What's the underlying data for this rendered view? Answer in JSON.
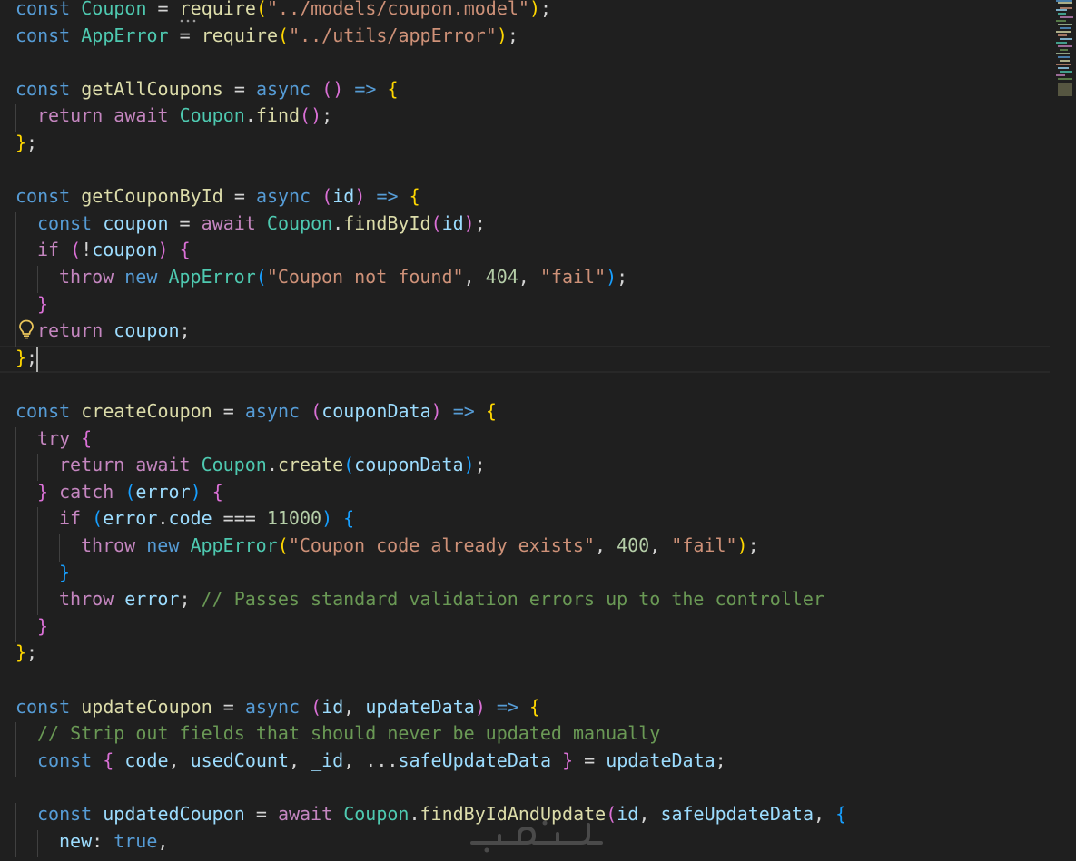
{
  "colors": {
    "background": "#1f1f1f",
    "keyword": "#569cd6",
    "control": "#c586c0",
    "variable": "#9cdcfe",
    "class": "#4ec9b0",
    "function": "#dcdcaa",
    "string": "#ce9178",
    "number": "#b5cea8",
    "comment": "#6a9955",
    "bracket1": "#ffd700",
    "bracket2": "#da70d6",
    "bracket3": "#179fff"
  },
  "editor": {
    "lightbulb_icon": "lightbulb-icon",
    "lines": [
      {
        "indent": 0,
        "tokens": [
          [
            "const",
            "kw"
          ],
          [
            " ",
            "pun"
          ],
          [
            "Coupon",
            "cls"
          ],
          [
            " = ",
            "op"
          ],
          [
            "require",
            "fn"
          ],
          [
            "(",
            "b1"
          ],
          [
            "\"../models/coupon.model\"",
            "str"
          ],
          [
            ")",
            "b1"
          ],
          [
            ";",
            "pun"
          ]
        ]
      },
      {
        "indent": 0,
        "tokens": [
          [
            "const",
            "kw"
          ],
          [
            " ",
            "pun"
          ],
          [
            "AppError",
            "cls"
          ],
          [
            " = ",
            "op"
          ],
          [
            "require",
            "fn"
          ],
          [
            "(",
            "b1"
          ],
          [
            "\"../utils/appError\"",
            "str"
          ],
          [
            ")",
            "b1"
          ],
          [
            ";",
            "pun"
          ]
        ]
      },
      {
        "indent": 0,
        "tokens": []
      },
      {
        "indent": 0,
        "tokens": [
          [
            "const",
            "kw"
          ],
          [
            " ",
            "pun"
          ],
          [
            "getAllCoupons",
            "fn"
          ],
          [
            " = ",
            "op"
          ],
          [
            "async",
            "kw"
          ],
          [
            " ",
            "pun"
          ],
          [
            "()",
            "b2"
          ],
          [
            " ",
            "pun"
          ],
          [
            "=>",
            "kw"
          ],
          [
            " ",
            "pun"
          ],
          [
            "{",
            "b1"
          ]
        ]
      },
      {
        "indent": 1,
        "tokens": [
          [
            "return",
            "ctl"
          ],
          [
            " ",
            "pun"
          ],
          [
            "await",
            "ctl"
          ],
          [
            " ",
            "pun"
          ],
          [
            "Coupon",
            "cls"
          ],
          [
            ".",
            "pun"
          ],
          [
            "find",
            "fn"
          ],
          [
            "()",
            "b2"
          ],
          [
            ";",
            "pun"
          ]
        ]
      },
      {
        "indent": 0,
        "tokens": [
          [
            "}",
            "b1"
          ],
          [
            ";",
            "pun"
          ]
        ]
      },
      {
        "indent": 0,
        "tokens": []
      },
      {
        "indent": 0,
        "tokens": [
          [
            "const",
            "kw"
          ],
          [
            " ",
            "pun"
          ],
          [
            "getCouponById",
            "fn"
          ],
          [
            " = ",
            "op"
          ],
          [
            "async",
            "kw"
          ],
          [
            " ",
            "pun"
          ],
          [
            "(",
            "b2"
          ],
          [
            "id",
            "var"
          ],
          [
            ")",
            "b2"
          ],
          [
            " ",
            "pun"
          ],
          [
            "=>",
            "kw"
          ],
          [
            " ",
            "pun"
          ],
          [
            "{",
            "b1"
          ]
        ]
      },
      {
        "indent": 1,
        "tokens": [
          [
            "const",
            "kw"
          ],
          [
            " ",
            "pun"
          ],
          [
            "coupon",
            "var"
          ],
          [
            " = ",
            "op"
          ],
          [
            "await",
            "ctl"
          ],
          [
            " ",
            "pun"
          ],
          [
            "Coupon",
            "cls"
          ],
          [
            ".",
            "pun"
          ],
          [
            "findById",
            "fn"
          ],
          [
            "(",
            "b2"
          ],
          [
            "id",
            "var"
          ],
          [
            ")",
            "b2"
          ],
          [
            ";",
            "pun"
          ]
        ]
      },
      {
        "indent": 1,
        "tokens": [
          [
            "if",
            "ctl"
          ],
          [
            " ",
            "pun"
          ],
          [
            "(",
            "b2"
          ],
          [
            "!",
            "op"
          ],
          [
            "coupon",
            "var"
          ],
          [
            ")",
            "b2"
          ],
          [
            " ",
            "pun"
          ],
          [
            "{",
            "b2"
          ]
        ]
      },
      {
        "indent": 2,
        "tokens": [
          [
            "throw",
            "ctl"
          ],
          [
            " ",
            "pun"
          ],
          [
            "new",
            "kw"
          ],
          [
            " ",
            "pun"
          ],
          [
            "AppError",
            "cls"
          ],
          [
            "(",
            "b3"
          ],
          [
            "\"Coupon not found\"",
            "str"
          ],
          [
            ", ",
            "pun"
          ],
          [
            "404",
            "num"
          ],
          [
            ", ",
            "pun"
          ],
          [
            "\"fail\"",
            "str"
          ],
          [
            ")",
            "b3"
          ],
          [
            ";",
            "pun"
          ]
        ]
      },
      {
        "indent": 1,
        "tokens": [
          [
            "}",
            "b2"
          ]
        ]
      },
      {
        "indent": 1,
        "tokens": [
          [
            "return",
            "ctl"
          ],
          [
            " ",
            "pun"
          ],
          [
            "coupon",
            "var"
          ],
          [
            ";",
            "pun"
          ]
        ]
      },
      {
        "indent": 0,
        "tokens": [
          [
            "}",
            "b1"
          ],
          [
            ";",
            "pun"
          ]
        ]
      },
      {
        "indent": 0,
        "tokens": []
      },
      {
        "indent": 0,
        "tokens": [
          [
            "const",
            "kw"
          ],
          [
            " ",
            "pun"
          ],
          [
            "createCoupon",
            "fn"
          ],
          [
            " = ",
            "op"
          ],
          [
            "async",
            "kw"
          ],
          [
            " ",
            "pun"
          ],
          [
            "(",
            "b2"
          ],
          [
            "couponData",
            "var"
          ],
          [
            ")",
            "b2"
          ],
          [
            " ",
            "pun"
          ],
          [
            "=>",
            "kw"
          ],
          [
            " ",
            "pun"
          ],
          [
            "{",
            "b1"
          ]
        ]
      },
      {
        "indent": 1,
        "tokens": [
          [
            "try",
            "ctl"
          ],
          [
            " ",
            "pun"
          ],
          [
            "{",
            "b2"
          ]
        ]
      },
      {
        "indent": 2,
        "tokens": [
          [
            "return",
            "ctl"
          ],
          [
            " ",
            "pun"
          ],
          [
            "await",
            "ctl"
          ],
          [
            " ",
            "pun"
          ],
          [
            "Coupon",
            "cls"
          ],
          [
            ".",
            "pun"
          ],
          [
            "create",
            "fn"
          ],
          [
            "(",
            "b3"
          ],
          [
            "couponData",
            "var"
          ],
          [
            ")",
            "b3"
          ],
          [
            ";",
            "pun"
          ]
        ]
      },
      {
        "indent": 1,
        "tokens": [
          [
            "}",
            "b2"
          ],
          [
            " ",
            "pun"
          ],
          [
            "catch",
            "ctl"
          ],
          [
            " ",
            "pun"
          ],
          [
            "(",
            "b3"
          ],
          [
            "error",
            "var"
          ],
          [
            ")",
            "b3"
          ],
          [
            " ",
            "pun"
          ],
          [
            "{",
            "b2"
          ]
        ]
      },
      {
        "indent": 2,
        "tokens": [
          [
            "if",
            "ctl"
          ],
          [
            " ",
            "pun"
          ],
          [
            "(",
            "b3"
          ],
          [
            "error",
            "var"
          ],
          [
            ".",
            "pun"
          ],
          [
            "code",
            "var"
          ],
          [
            " === ",
            "op"
          ],
          [
            "11000",
            "num"
          ],
          [
            ")",
            "b3"
          ],
          [
            " ",
            "pun"
          ],
          [
            "{",
            "b3"
          ]
        ]
      },
      {
        "indent": 3,
        "tokens": [
          [
            "throw",
            "ctl"
          ],
          [
            " ",
            "pun"
          ],
          [
            "new",
            "kw"
          ],
          [
            " ",
            "pun"
          ],
          [
            "AppError",
            "cls"
          ],
          [
            "(",
            "b1"
          ],
          [
            "\"Coupon code already exists\"",
            "str"
          ],
          [
            ", ",
            "pun"
          ],
          [
            "400",
            "num"
          ],
          [
            ", ",
            "pun"
          ],
          [
            "\"fail\"",
            "str"
          ],
          [
            ")",
            "b1"
          ],
          [
            ";",
            "pun"
          ]
        ]
      },
      {
        "indent": 2,
        "tokens": [
          [
            "}",
            "b3"
          ]
        ]
      },
      {
        "indent": 2,
        "tokens": [
          [
            "throw",
            "ctl"
          ],
          [
            " ",
            "pun"
          ],
          [
            "error",
            "var"
          ],
          [
            ";",
            "pun"
          ],
          [
            " ",
            "pun"
          ],
          [
            "// Passes standard validation errors up to the controller",
            "cmt"
          ]
        ]
      },
      {
        "indent": 1,
        "tokens": [
          [
            "}",
            "b2"
          ]
        ]
      },
      {
        "indent": 0,
        "tokens": [
          [
            "}",
            "b1"
          ],
          [
            ";",
            "pun"
          ]
        ]
      },
      {
        "indent": 0,
        "tokens": []
      },
      {
        "indent": 0,
        "tokens": [
          [
            "const",
            "kw"
          ],
          [
            " ",
            "pun"
          ],
          [
            "updateCoupon",
            "fn"
          ],
          [
            " = ",
            "op"
          ],
          [
            "async",
            "kw"
          ],
          [
            " ",
            "pun"
          ],
          [
            "(",
            "b2"
          ],
          [
            "id",
            "var"
          ],
          [
            ", ",
            "pun"
          ],
          [
            "updateData",
            "var"
          ],
          [
            ")",
            "b2"
          ],
          [
            " ",
            "pun"
          ],
          [
            "=>",
            "kw"
          ],
          [
            " ",
            "pun"
          ],
          [
            "{",
            "b1"
          ]
        ]
      },
      {
        "indent": 1,
        "tokens": [
          [
            "// Strip out fields that should never be updated manually",
            "cmt"
          ]
        ]
      },
      {
        "indent": 1,
        "tokens": [
          [
            "const",
            "kw"
          ],
          [
            " ",
            "pun"
          ],
          [
            "{",
            "b2"
          ],
          [
            " ",
            "pun"
          ],
          [
            "code",
            "var"
          ],
          [
            ", ",
            "pun"
          ],
          [
            "usedCount",
            "var"
          ],
          [
            ", ",
            "pun"
          ],
          [
            "_id",
            "var"
          ],
          [
            ", ...",
            "pun"
          ],
          [
            "safeUpdateData",
            "var"
          ],
          [
            " ",
            "pun"
          ],
          [
            "}",
            "b2"
          ],
          [
            " = ",
            "op"
          ],
          [
            "updateData",
            "var"
          ],
          [
            ";",
            "pun"
          ]
        ]
      },
      {
        "indent": 0,
        "tokens": []
      },
      {
        "indent": 1,
        "tokens": [
          [
            "const",
            "kw"
          ],
          [
            " ",
            "pun"
          ],
          [
            "updatedCoupon",
            "var"
          ],
          [
            " = ",
            "op"
          ],
          [
            "await",
            "ctl"
          ],
          [
            " ",
            "pun"
          ],
          [
            "Coupon",
            "cls"
          ],
          [
            ".",
            "pun"
          ],
          [
            "findByIdAndUpdate",
            "fn"
          ],
          [
            "(",
            "b2"
          ],
          [
            "id",
            "var"
          ],
          [
            ", ",
            "pun"
          ],
          [
            "safeUpdateData",
            "var"
          ],
          [
            ", ",
            "pun"
          ],
          [
            "{",
            "b3"
          ]
        ]
      },
      {
        "indent": 2,
        "tokens": [
          [
            "new",
            "var"
          ],
          [
            ": ",
            "pun"
          ],
          [
            "true",
            "kw"
          ],
          [
            ",",
            "pun"
          ]
        ]
      }
    ]
  }
}
